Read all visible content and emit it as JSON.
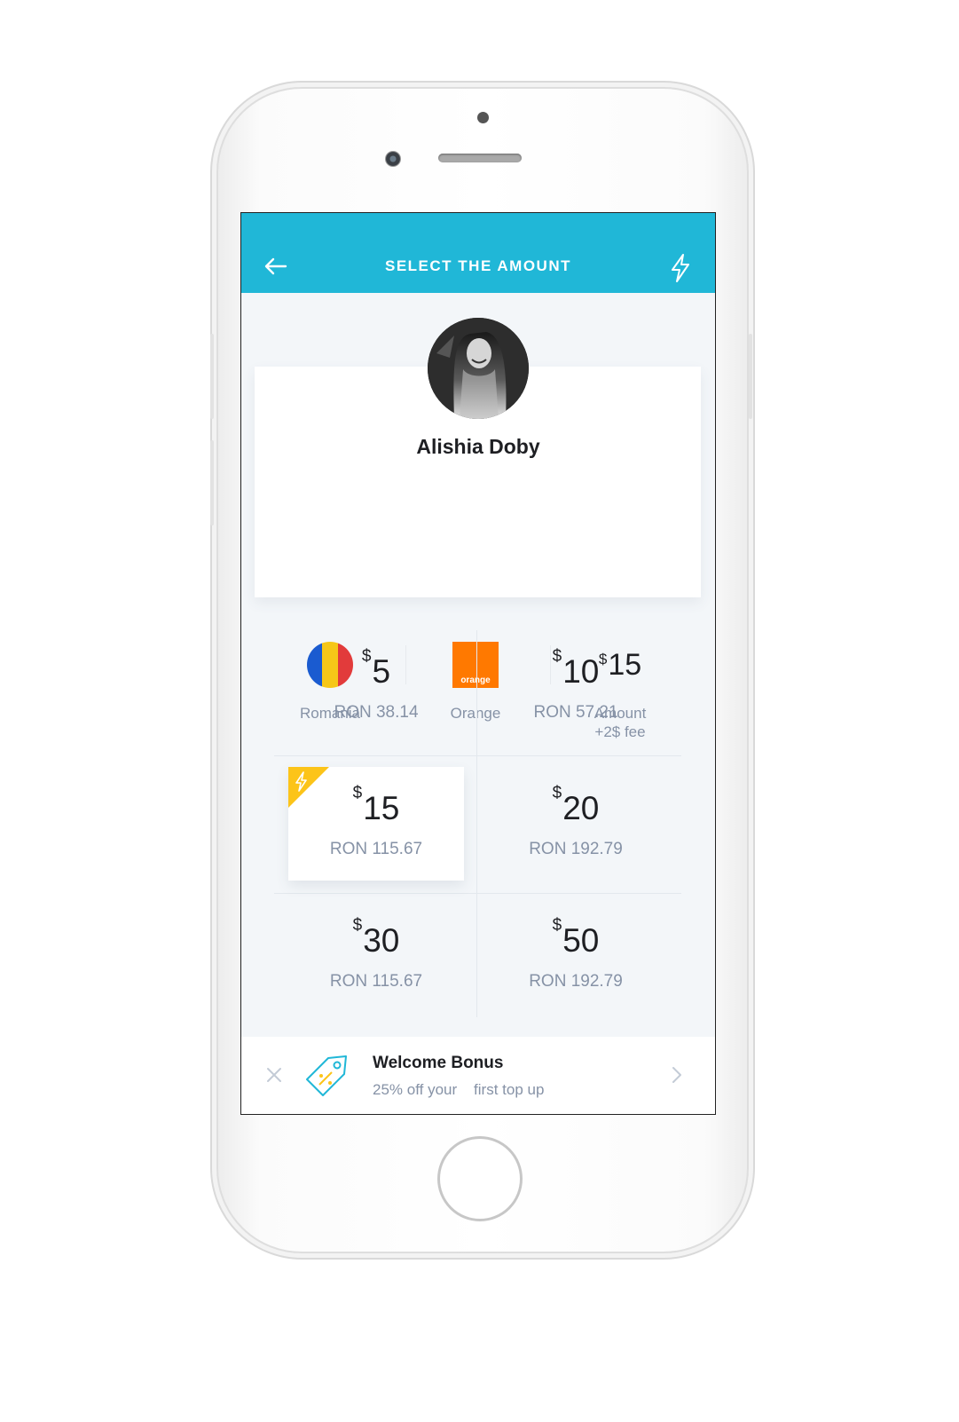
{
  "header": {
    "title": "SELECT THE AMOUNT",
    "back_icon": "arrow-left-icon",
    "action_icon": "lightning-icon",
    "color": "#20b7d7"
  },
  "contact": {
    "name": "Alishia Doby",
    "country": "Romania",
    "country_flag_colors": [
      "#1a5bd0",
      "#f6c718",
      "#e23b3b"
    ],
    "operator": "Orange",
    "operator_logo_text": "orange",
    "operator_color": "#ff7900",
    "amount_value": "15",
    "amount_currency": "$",
    "amount_label_line1": "Amount",
    "amount_label_line2": "+2$ fee"
  },
  "options": [
    {
      "currency": "$",
      "amount": "5",
      "local": "RON 38.14",
      "selected": false
    },
    {
      "currency": "$",
      "amount": "10",
      "local": "RON 57.21",
      "selected": false
    },
    {
      "currency": "$",
      "amount": "15",
      "local": "RON 115.67",
      "selected": true,
      "badge_icon": "lightning-icon",
      "badge_color": "#fcc419"
    },
    {
      "currency": "$",
      "amount": "20",
      "local": "RON 192.79",
      "selected": false
    },
    {
      "currency": "$",
      "amount": "30",
      "local": "RON 115.67",
      "selected": false
    },
    {
      "currency": "$",
      "amount": "50",
      "local": "RON 192.79",
      "selected": false
    }
  ],
  "bonus": {
    "title": "Welcome Bonus",
    "text": "25% off your    first top up",
    "icon": "price-tag-icon",
    "close_icon": "close-icon",
    "arrow_icon": "chevron-right-icon"
  }
}
